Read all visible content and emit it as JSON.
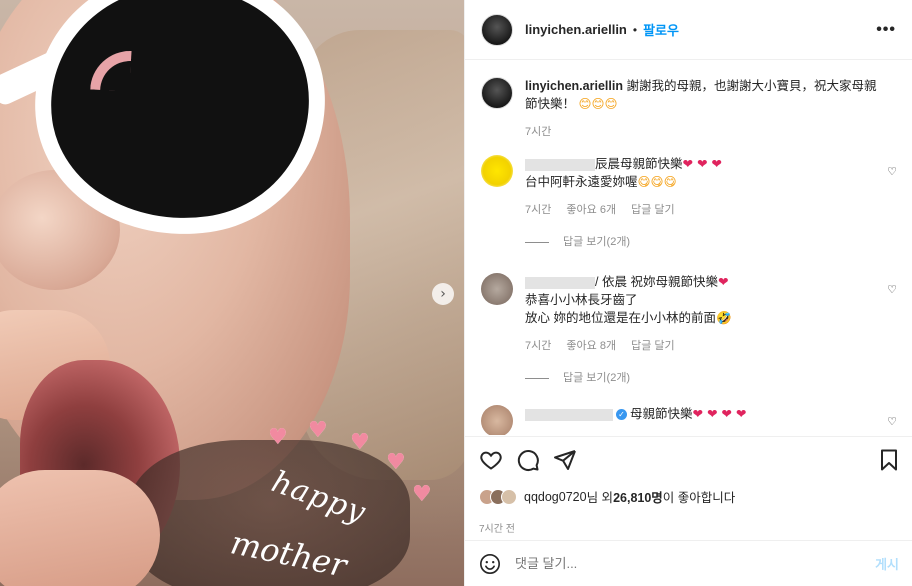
{
  "photo": {
    "overlay_text_1": "happy",
    "overlay_text_2": "mother"
  },
  "header": {
    "username": "linyichen.ariellin",
    "dot": "•",
    "follow_label": "팔로우",
    "more_label": "•••"
  },
  "caption": {
    "username": "linyichen.ariellin",
    "text": "謝謝我的母親，也謝謝大小寶貝，祝大家母親節快樂！",
    "emojis": "😊😊😊",
    "time": "7시간"
  },
  "comments": [
    {
      "username_tail": "辰晨",
      "text_line1": "母親節快樂",
      "hearts1": "❤ ❤ ❤",
      "text_line2": "台中阿軒永遠愛妳喔",
      "emojis2": "😋😋😋",
      "time": "7시간",
      "likes": "좋아요 6개",
      "reply": "답글 달기",
      "view_replies": "답글 보기(2개)"
    },
    {
      "username_tail": "/ 依晨",
      "text_line1": "祝妳母親節快樂",
      "hearts1": "❤",
      "text_line2": "恭喜小小林長牙齒了",
      "text_line3": "放心 妳的地位還是在小小林的前面",
      "emojis3": "🤣",
      "time": "7시간",
      "likes": "좋아요 8개",
      "reply": "답글 달기",
      "view_replies": "답글 보기(2개)"
    },
    {
      "text_line1": "母親節快樂",
      "hearts1": "❤ ❤ ❤ ❤"
    }
  ],
  "likes": {
    "liker": "qqdog0720",
    "suffix_1": "님 외 ",
    "count": "26,810명",
    "suffix_2": "이 좋아합니다"
  },
  "post_time": "7시간 전",
  "add_comment": {
    "placeholder": "댓글 달기...",
    "post_label": "게시"
  }
}
